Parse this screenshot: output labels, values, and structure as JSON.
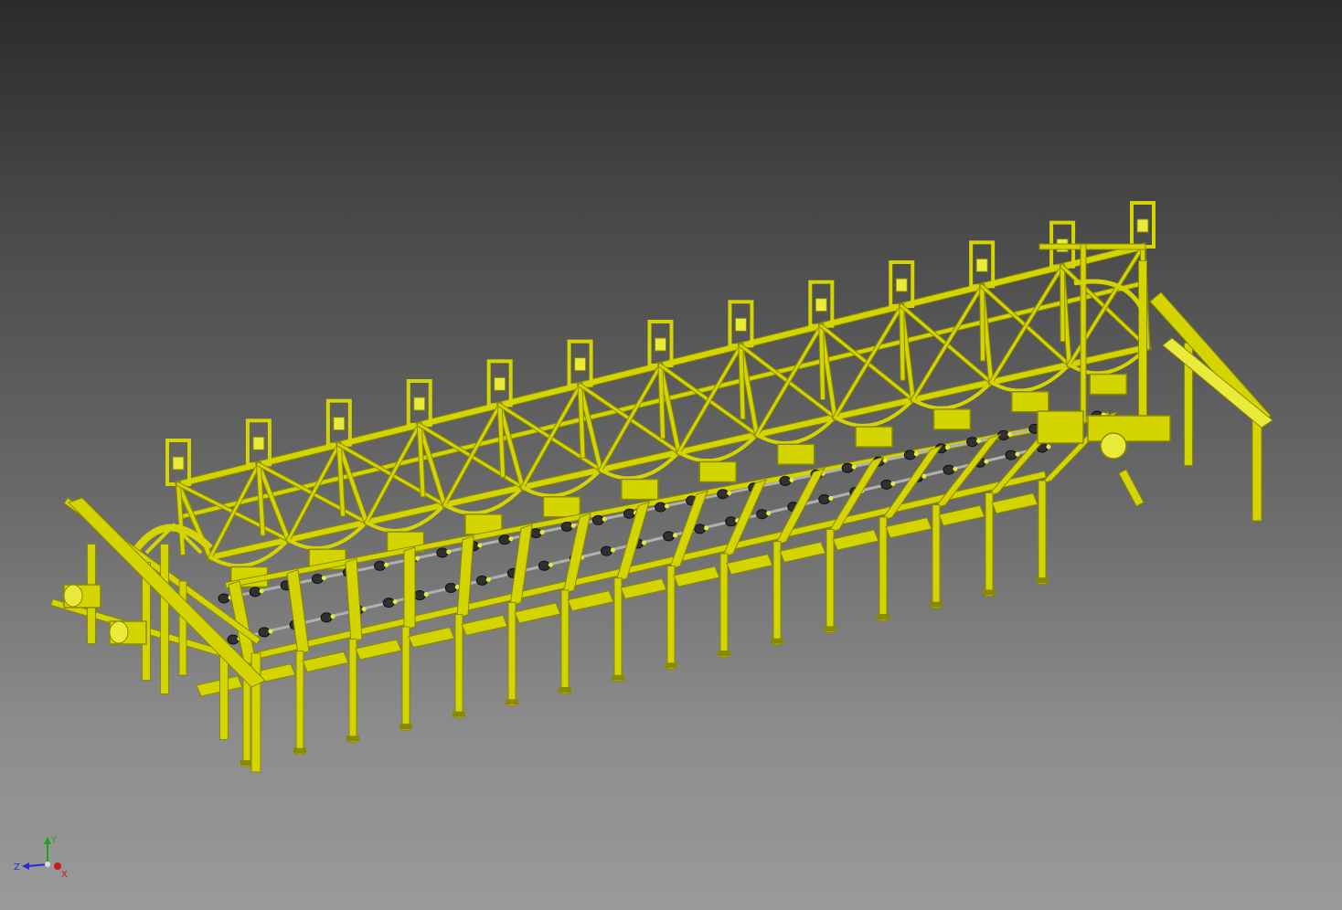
{
  "viewport": {
    "background_top": "#2b2b2b",
    "background_bottom": "#9a9a9a"
  },
  "model": {
    "color": "#d4d400",
    "shadow_color": "#8a8a00",
    "highlight_color": "#eaea3a",
    "roller_color": "#303030",
    "shaft_color": "#b0b0b0",
    "upper_gantry_bays": 12,
    "lower_conveyor_legs": 16
  },
  "view_cube_triad": {
    "y_label": "Y",
    "z_label": "Z",
    "x_label": "X",
    "y_color": "#1aa81a",
    "z_color": "#2a2ad8",
    "x_color": "#c81a1a"
  }
}
